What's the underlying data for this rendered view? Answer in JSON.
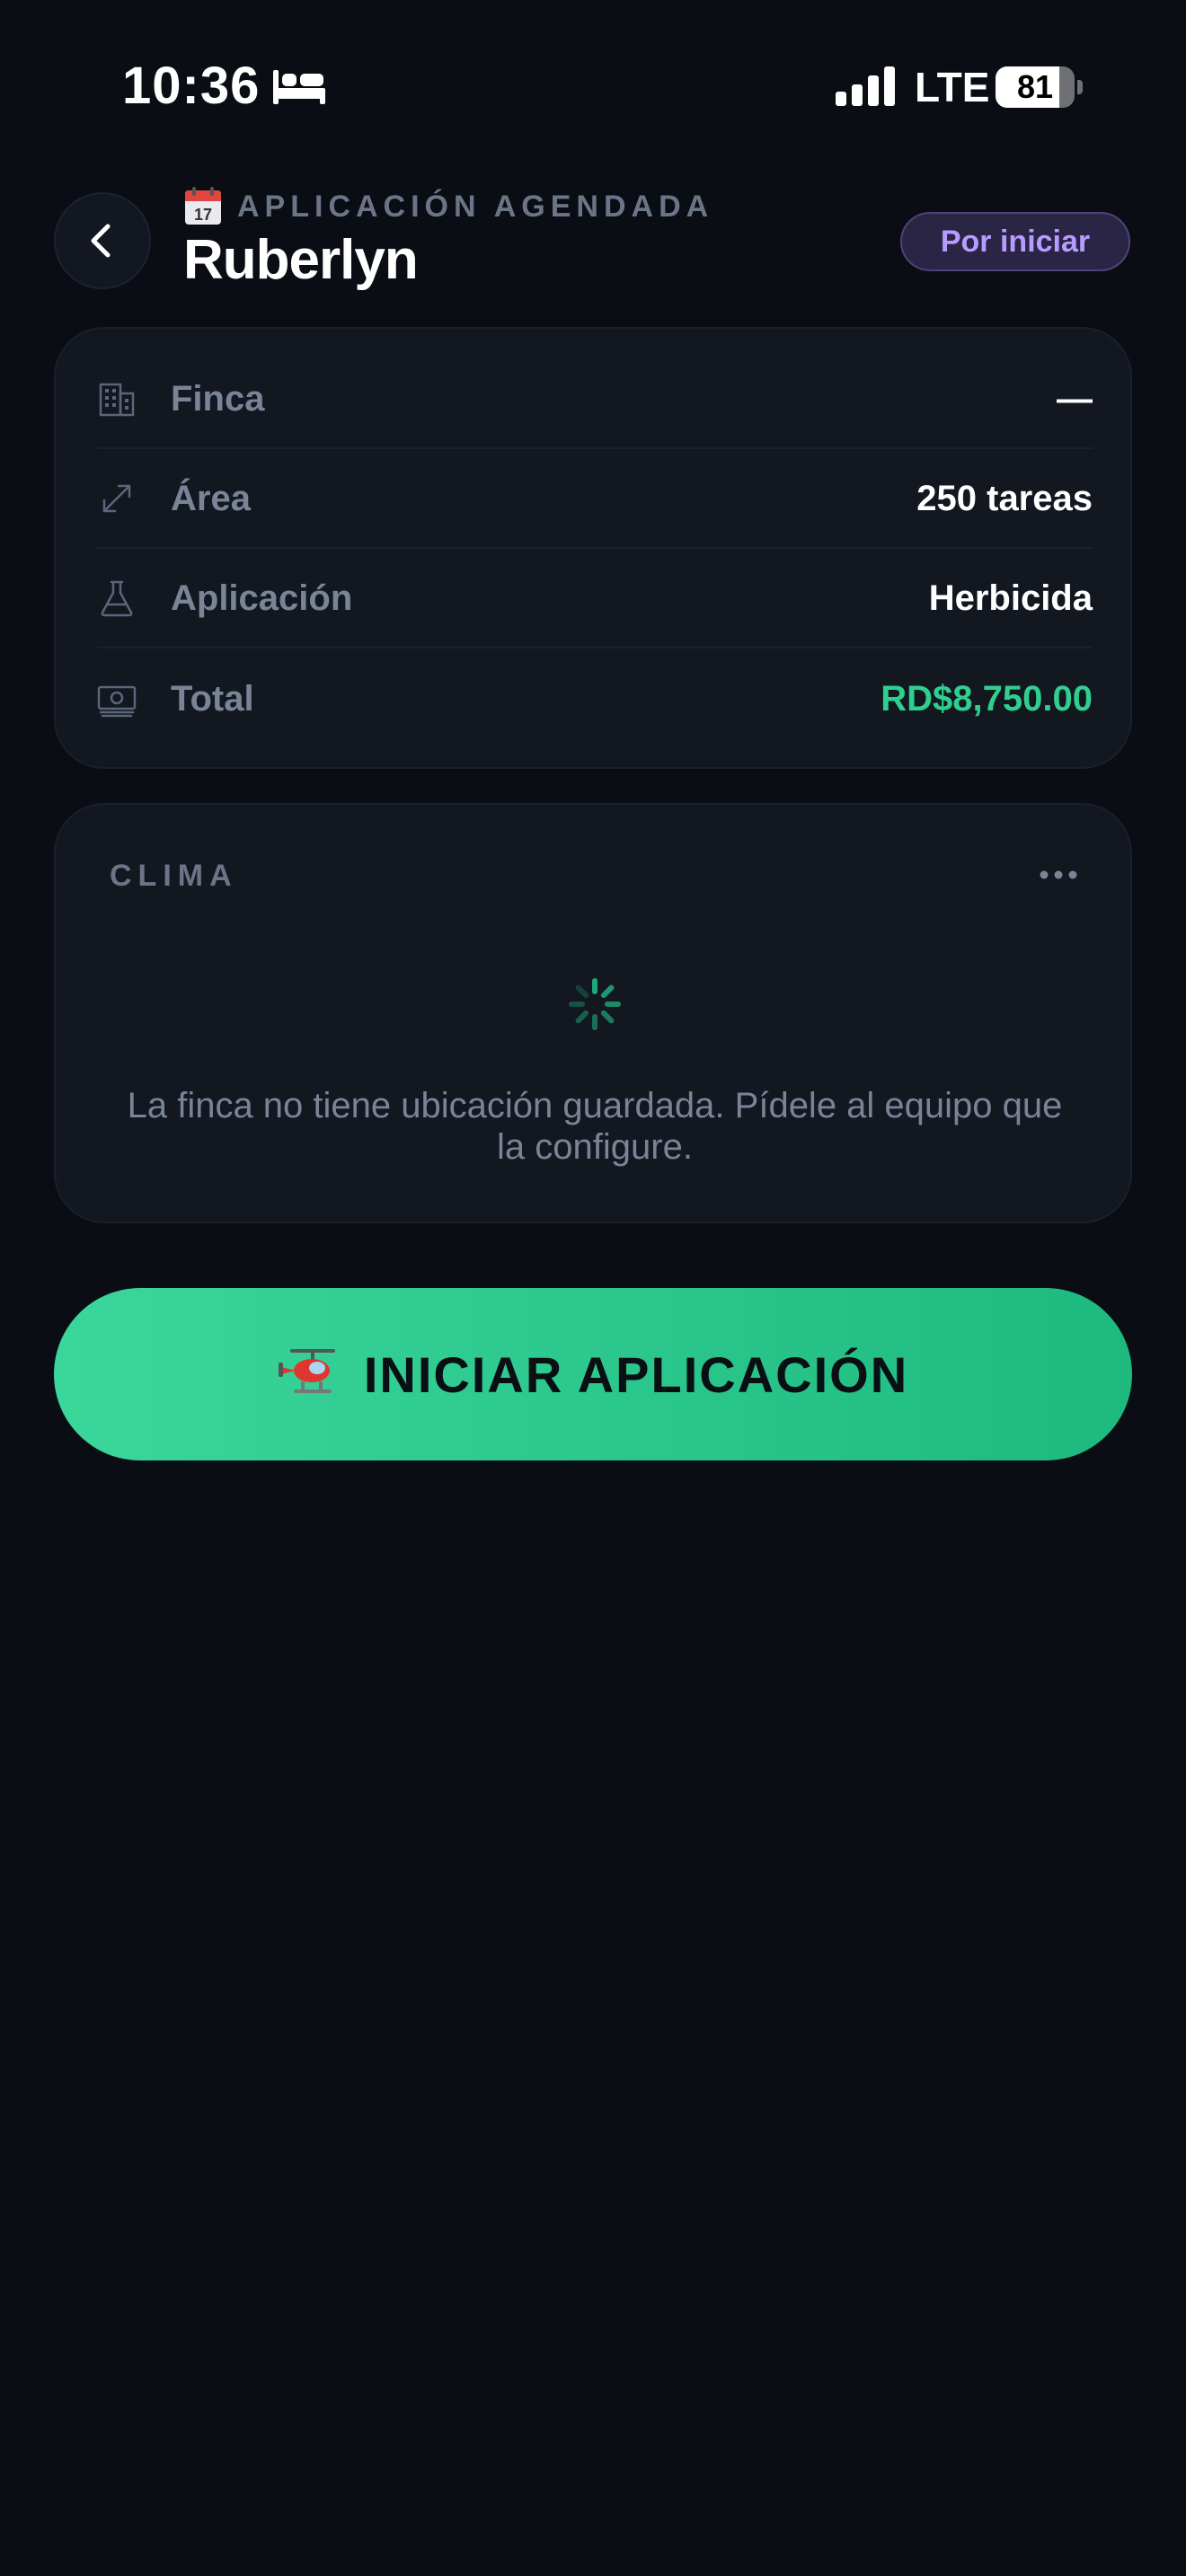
{
  "status_bar": {
    "time": "10:36",
    "network": "LTE",
    "battery_percent": 81,
    "battery_label": "81",
    "focus_icon": "bed-icon",
    "signal_icon": "signal-icon"
  },
  "header": {
    "back_icon": "chevron-left-icon",
    "eyebrow_icon": "calendar-icon",
    "eyebrow": "APLICACIÓN AGENDADA",
    "title": "Ruberlyn",
    "status_badge": "Por iniciar"
  },
  "info": {
    "rows": [
      {
        "icon": "building-icon",
        "label": "Finca",
        "value": "—"
      },
      {
        "icon": "resize-arrows-icon",
        "label": "Área",
        "value": "250 tareas"
      },
      {
        "icon": "flask-icon",
        "label": "Aplicación",
        "value": "Herbicida"
      },
      {
        "icon": "money-icon",
        "label": "Total",
        "value": "RD$8,750.00"
      }
    ]
  },
  "weather": {
    "title": "CLIMA",
    "menu_icon": "more-icon",
    "loading_icon": "spinner-icon",
    "message": "La finca no tiene ubicación guardada. Pídele al equipo que la configure."
  },
  "cta": {
    "icon": "helicopter-icon",
    "label": "INICIAR APLICACIÓN"
  },
  "colors": {
    "background": "#0a0d14",
    "card": "#121720",
    "accent_green": "#2fcf8f",
    "badge_purple": "#b79cff",
    "muted_text": "#7a8497"
  }
}
